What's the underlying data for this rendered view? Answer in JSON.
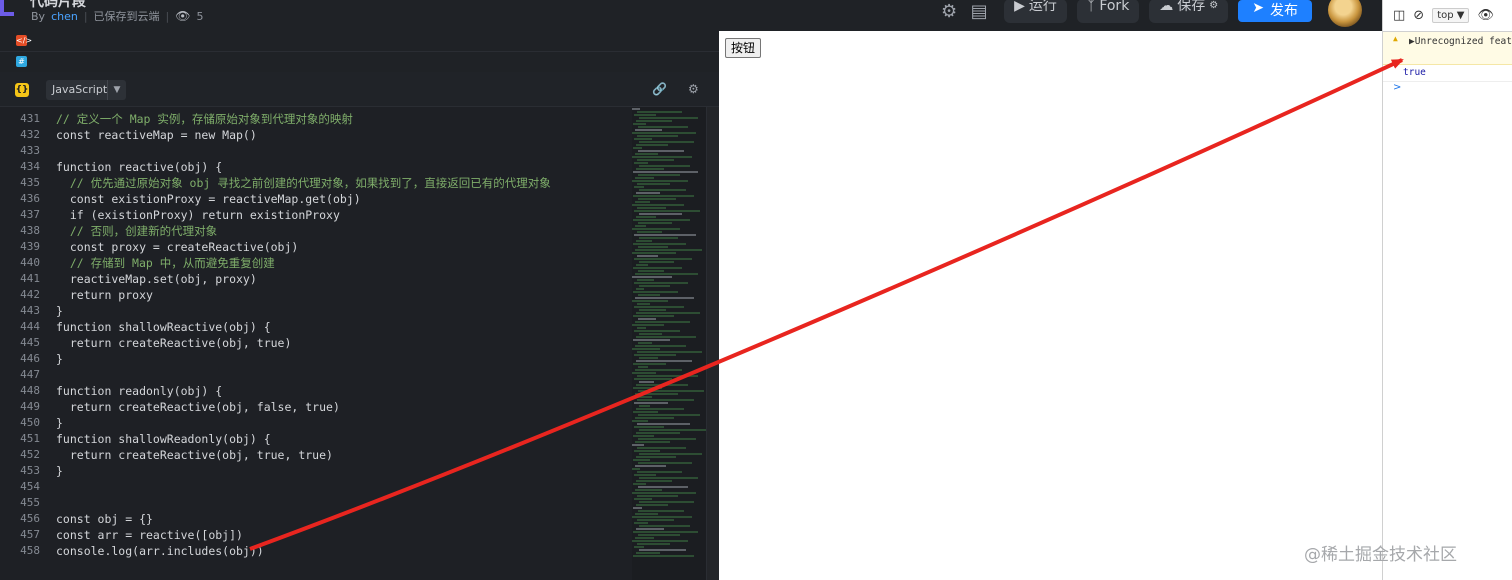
{
  "header": {
    "title": "代码片段",
    "by_label": "By",
    "author": "chen",
    "save_status": "已保存到云端",
    "views": "5",
    "run_label": "运行",
    "fork_label": "Fork",
    "save_label": "保存",
    "publish_label": "发布"
  },
  "editor": {
    "language": "JavaScript",
    "lines": [
      {
        "n": "431",
        "t": "// 定义一个 Map 实例，存储原始对象到代理对象的映射",
        "c": true
      },
      {
        "n": "432",
        "t": "const reactiveMap = new Map()",
        "c": false
      },
      {
        "n": "433",
        "t": "",
        "c": false
      },
      {
        "n": "434",
        "t": "function reactive(obj) {",
        "c": false
      },
      {
        "n": "435",
        "t": "  // 优先通过原始对象 obj 寻找之前创建的代理对象，如果找到了，直接返回已有的代理对象",
        "c": true
      },
      {
        "n": "436",
        "t": "  const existionProxy = reactiveMap.get(obj)",
        "c": false
      },
      {
        "n": "437",
        "t": "  if (existionProxy) return existionProxy",
        "c": false
      },
      {
        "n": "438",
        "t": "  // 否则，创建新的代理对象",
        "c": true
      },
      {
        "n": "439",
        "t": "  const proxy = createReactive(obj)",
        "c": false
      },
      {
        "n": "440",
        "t": "  // 存储到 Map 中，从而避免重复创建",
        "c": true
      },
      {
        "n": "441",
        "t": "  reactiveMap.set(obj, proxy)",
        "c": false
      },
      {
        "n": "442",
        "t": "  return proxy",
        "c": false
      },
      {
        "n": "443",
        "t": "}",
        "c": false
      },
      {
        "n": "444",
        "t": "function shallowReactive(obj) {",
        "c": false
      },
      {
        "n": "445",
        "t": "  return createReactive(obj, true)",
        "c": false
      },
      {
        "n": "446",
        "t": "}",
        "c": false
      },
      {
        "n": "447",
        "t": "",
        "c": false
      },
      {
        "n": "448",
        "t": "function readonly(obj) {",
        "c": false
      },
      {
        "n": "449",
        "t": "  return createReactive(obj, false, true)",
        "c": false
      },
      {
        "n": "450",
        "t": "}",
        "c": false
      },
      {
        "n": "451",
        "t": "function shallowReadonly(obj) {",
        "c": false
      },
      {
        "n": "452",
        "t": "  return createReactive(obj, true, true)",
        "c": false
      },
      {
        "n": "453",
        "t": "}",
        "c": false
      },
      {
        "n": "454",
        "t": "",
        "c": false
      },
      {
        "n": "455",
        "t": "",
        "c": false
      },
      {
        "n": "456",
        "t": "const obj = {}",
        "c": false
      },
      {
        "n": "457",
        "t": "const arr = reactive([obj])",
        "c": false
      },
      {
        "n": "458",
        "t": "console.log(arr.includes(obj))",
        "c": false
      }
    ]
  },
  "preview": {
    "button_label": "按钮"
  },
  "devtools": {
    "context": "top",
    "warning": "Unrecognized feature",
    "output": "true",
    "prompt": ">"
  },
  "watermark": "@稀土掘金技术社区",
  "colors": {
    "accent": "#1e80ff",
    "arrow": "#e8251f",
    "comment": "#7fae6a"
  }
}
